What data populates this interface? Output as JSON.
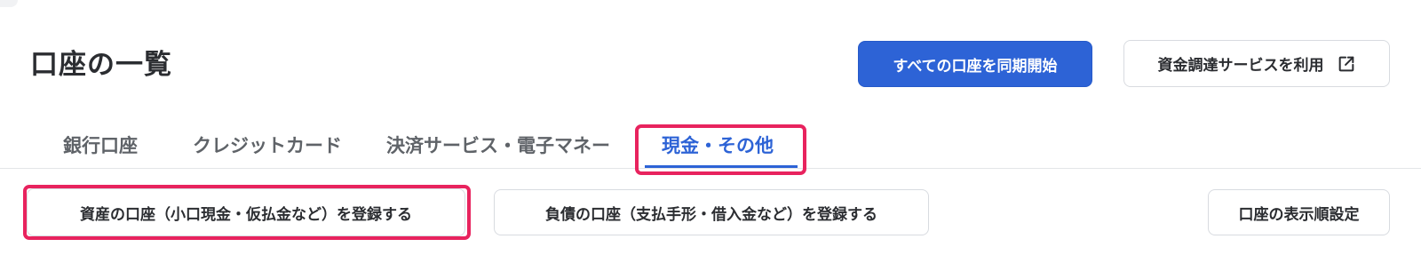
{
  "page": {
    "title": "口座の一覧"
  },
  "header": {
    "sync_all_label": "すべての口座を同期開始",
    "funding_label": "資金調達サービスを利用",
    "funding_icon": "external-link-icon"
  },
  "tabs": [
    {
      "label": "銀行口座",
      "active": false
    },
    {
      "label": "クレジットカード",
      "active": false
    },
    {
      "label": "決済サービス・電子マネー",
      "active": false
    },
    {
      "label": "現金・その他",
      "active": true
    }
  ],
  "actions": {
    "register_asset_label": "資産の口座（小口現金・仮払金など）を登録する",
    "register_liability_label": "負債の口座（支払手形・借入金など）を登録する",
    "display_order_label": "口座の表示順設定"
  },
  "colors": {
    "accent": "#2d63d6",
    "highlight": "#e8235e",
    "text": "#2b2d31",
    "muted_tab": "#5f6368"
  }
}
